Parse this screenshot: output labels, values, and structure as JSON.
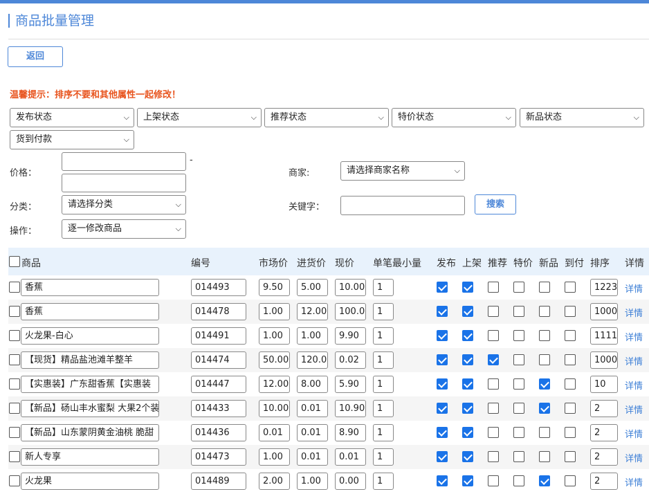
{
  "header": {
    "title": "商品批量管理",
    "back_label": "返回"
  },
  "tip": "温馨提示：排序不要和其他属性一起修改！",
  "filters": {
    "status_selects": [
      "发布状态",
      "上架状态",
      "推荐状态",
      "特价状态",
      "新品状态",
      "货到付款"
    ],
    "price_label": "价格：",
    "price_separator": "-",
    "merchant_label": "商家:",
    "merchant_value": "请选择商家名称",
    "category_label": "分类：",
    "category_value": "请选择分类",
    "keyword_label": "关键字：",
    "search_label": "搜索",
    "operation_label": "操作：",
    "operation_value": "逐一修改商品"
  },
  "table": {
    "headers": {
      "product": "商品",
      "code": "编号",
      "market_price": "市场价",
      "purchase_price": "进货价",
      "current_price": "现价",
      "min_qty": "单笔最小量",
      "publish": "发布",
      "shelf": "上架",
      "recommend": "推荐",
      "special": "特价",
      "new": "新品",
      "cod": "到付",
      "sort": "排序",
      "detail": "详情"
    },
    "detail_label": "详情",
    "rows": [
      {
        "name": "香蕉",
        "code": "014493",
        "market": "9.50",
        "purchase": "5.00",
        "price": "10.00",
        "min": "1",
        "publish": true,
        "shelf": true,
        "recommend": false,
        "special": false,
        "new": false,
        "cod": false,
        "sort": "1223"
      },
      {
        "name": "香蕉",
        "code": "014478",
        "market": "1.00",
        "purchase": "12.00",
        "price": "100.0",
        "min": "1",
        "publish": true,
        "shelf": true,
        "recommend": false,
        "special": false,
        "new": false,
        "cod": false,
        "sort": "1000"
      },
      {
        "name": "火龙果-白心",
        "code": "014491",
        "market": "1.00",
        "purchase": "1.00",
        "price": "9.90",
        "min": "1",
        "publish": true,
        "shelf": true,
        "recommend": false,
        "special": false,
        "new": false,
        "cod": false,
        "sort": "1111"
      },
      {
        "name": "【现货】精品盐池滩羊整羊",
        "code": "014474",
        "market": "50.00",
        "purchase": "120.0",
        "price": "0.02",
        "min": "1",
        "publish": true,
        "shelf": true,
        "recommend": true,
        "special": false,
        "new": false,
        "cod": false,
        "sort": "1000"
      },
      {
        "name": "【实惠装】广东甜香蕉【实惠装",
        "code": "014447",
        "market": "12.00",
        "purchase": "8.00",
        "price": "5.90",
        "min": "1",
        "publish": true,
        "shelf": true,
        "recommend": false,
        "special": false,
        "new": true,
        "cod": false,
        "sort": "10"
      },
      {
        "name": "【新品】砀山丰水蜜梨 大果2个装",
        "code": "014433",
        "market": "10.00",
        "purchase": "0.01",
        "price": "10.90",
        "min": "1",
        "publish": true,
        "shelf": true,
        "recommend": false,
        "special": false,
        "new": true,
        "cod": false,
        "sort": "2"
      },
      {
        "name": "【新品】山东蒙阴黄金油桃 脆甜",
        "code": "014436",
        "market": "0.01",
        "purchase": "0.01",
        "price": "8.90",
        "min": "1",
        "publish": true,
        "shelf": true,
        "recommend": false,
        "special": false,
        "new": false,
        "cod": false,
        "sort": "2"
      },
      {
        "name": "新人专享",
        "code": "014473",
        "market": "1.00",
        "purchase": "0.01",
        "price": "0.01",
        "min": "1",
        "publish": true,
        "shelf": true,
        "recommend": false,
        "special": false,
        "new": false,
        "cod": false,
        "sort": "2"
      },
      {
        "name": "火龙果",
        "code": "014489",
        "market": "2.00",
        "purchase": "1.00",
        "price": "0.00",
        "min": "1",
        "publish": true,
        "shelf": true,
        "recommend": false,
        "special": false,
        "new": true,
        "cod": false,
        "sort": "2"
      }
    ]
  },
  "colors": {
    "accent": "#4d87d8",
    "warning": "#e8541e",
    "checkbox_on": "#1a73e8"
  }
}
